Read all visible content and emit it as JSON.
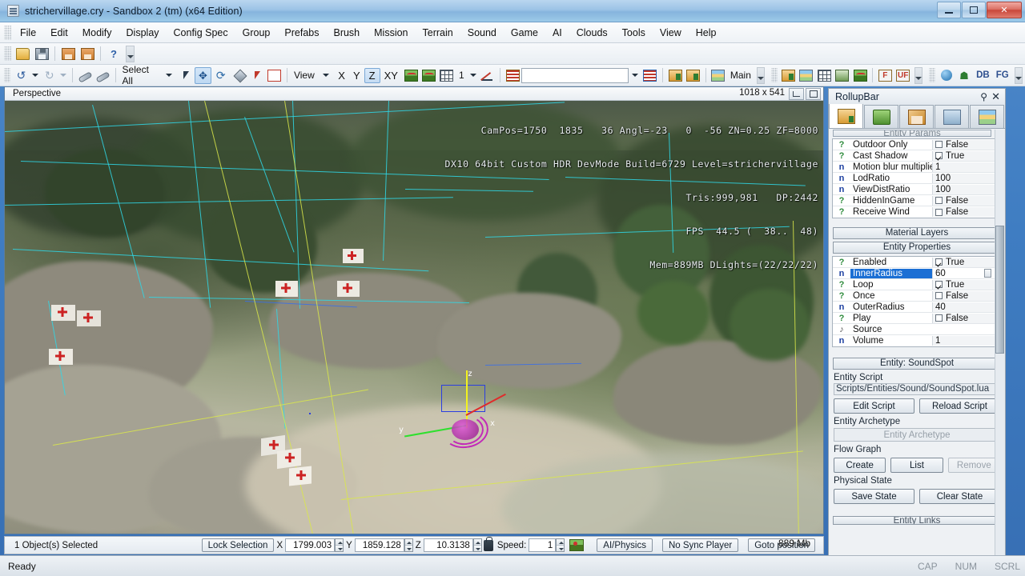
{
  "window": {
    "title": "strichervillage.cry - Sandbox 2 (tm) (x64 Edition)",
    "icon": "app-icon",
    "minimize": "–",
    "maximize": "▣",
    "close": "✕"
  },
  "menubar": {
    "items": [
      {
        "label": "File"
      },
      {
        "label": "Edit"
      },
      {
        "label": "Modify"
      },
      {
        "label": "Display"
      },
      {
        "label": "Config Spec"
      },
      {
        "label": "Group"
      },
      {
        "label": "Prefabs"
      },
      {
        "label": "Brush"
      },
      {
        "label": "Mission"
      },
      {
        "label": "Terrain"
      },
      {
        "label": "Sound"
      },
      {
        "label": "Game"
      },
      {
        "label": "AI"
      },
      {
        "label": "Clouds"
      },
      {
        "label": "Tools"
      },
      {
        "label": "View"
      },
      {
        "label": "Help"
      }
    ]
  },
  "toolbar_file": {
    "items": [
      {
        "name": "open-file-button",
        "icon": "folder-open-icon"
      },
      {
        "name": "save-button",
        "icon": "floppy-save-icon"
      },
      {
        "name": "save-level-resources-button",
        "icon": "save-down-icon"
      },
      {
        "name": "export-button",
        "icon": "save-up-icon"
      },
      {
        "name": "help-button",
        "icon": "question-mark-icon"
      }
    ],
    "overflow": "▾"
  },
  "toolbar_edit": {
    "undo": "undo-icon",
    "redo": "redo-icon",
    "link": "link-icon",
    "unlink": "unlink-icon",
    "select_combo": "Select All",
    "tools": [
      {
        "name": "select-tool",
        "icon": "arrow-cursor-icon",
        "active": false
      },
      {
        "name": "move-tool",
        "icon": "move-gizmo-icon",
        "active": true
      },
      {
        "name": "rotate-tool",
        "icon": "rotate-icon",
        "active": false
      },
      {
        "name": "scale-tool",
        "icon": "scale-icon",
        "active": false
      },
      {
        "name": "select-terrain-tool",
        "icon": "select-object-icon",
        "active": false
      },
      {
        "name": "select-area-tool",
        "icon": "select-area-icon",
        "active": false
      }
    ],
    "view_combo": "View",
    "axis_x": "X",
    "axis_y": "Y",
    "axis_z": "Z",
    "axis_xy": "XY",
    "terrain_snap": "terrain-snap-icon",
    "terrain_object_snap": "terrain-object-snap-icon",
    "grid_snap": "grid-snap-icon",
    "grid_value": "1",
    "angle_snap": "angle-snap-icon",
    "goto_selection": "goto-selection-icon",
    "layer_combo": "",
    "check_level": "check-level-icon",
    "import_button": "import-icon",
    "export_button": "export-icon",
    "layers_icon": "layers-icon",
    "layer_name": "Main",
    "right_tools": [
      {
        "name": "open-database-view-button",
        "icon": "database-icon"
      },
      {
        "name": "material-editor-button",
        "icon": "material-icon"
      },
      {
        "name": "terrain-editor-button",
        "icon": "terrain-grid-icon"
      },
      {
        "name": "character-editor-button",
        "icon": "character-icon"
      },
      {
        "name": "terrain-texture-button",
        "icon": "terrain-texture-icon"
      },
      {
        "name": "facial-editor-button",
        "icon": "facial-f-icon"
      },
      {
        "name": "ui-editor-button",
        "icon": "ui-f-icon"
      },
      {
        "name": "smart-objects-button",
        "icon": "blue-sphere-icon"
      },
      {
        "name": "ai-debugger-button",
        "icon": "green-man-icon"
      },
      {
        "name": "db-button",
        "icon": "db-text-icon"
      },
      {
        "name": "fg-button",
        "icon": "fg-text-icon"
      }
    ],
    "db_label": "DB",
    "fg_label": "FG"
  },
  "viewport": {
    "label": "Perspective",
    "resolution": "1018 x 541",
    "btn_maximize": "maximize-viewport-icon",
    "btn_layout": "viewport-layout-icon",
    "debug_lines": [
      "CamPos=1750  1835   36 Angl=-23   0  -56 ZN=0.25 ZF=8000",
      "DX10 64bit Custom HDR DevMode Build=6729 Level=strichervillage",
      "Tris:999,981   DP:2442",
      "FPS  44.5 (  38..  48)",
      "Mem=889MB DLights=(22/22/22)"
    ],
    "gizmo": {
      "x_label": "x",
      "y_label": "y",
      "z_label": "z"
    }
  },
  "rollup": {
    "title": "RollupBar",
    "pin_icon": "pin-icon",
    "close_icon": "close-icon",
    "tabs": [
      {
        "name": "tab-objects",
        "icon": "objects-icon",
        "active": true
      },
      {
        "name": "tab-terrain",
        "icon": "terrain-tab-icon",
        "active": false
      },
      {
        "name": "tab-modelling",
        "icon": "pencil-icon",
        "active": false
      },
      {
        "name": "tab-display",
        "icon": "display-monitor-icon",
        "active": false
      },
      {
        "name": "tab-layers",
        "icon": "layers-tab-icon",
        "active": false
      }
    ],
    "entity_params_header": "Entity Params",
    "entity_params": [
      {
        "type": "?",
        "name": "Outdoor Only",
        "value": "False",
        "kind": "bool",
        "checked": false
      },
      {
        "type": "?",
        "name": "Cast Shadow",
        "value": "True",
        "kind": "bool",
        "checked": true
      },
      {
        "type": "n",
        "name": "Motion blur multiplier",
        "value": "1",
        "kind": "num"
      },
      {
        "type": "n",
        "name": "LodRatio",
        "value": "100",
        "kind": "num"
      },
      {
        "type": "n",
        "name": "ViewDistRatio",
        "value": "100",
        "kind": "num"
      },
      {
        "type": "?",
        "name": "HiddenInGame",
        "value": "False",
        "kind": "bool",
        "checked": false
      },
      {
        "type": "?",
        "name": "Receive Wind",
        "value": "False",
        "kind": "bool",
        "checked": false
      }
    ],
    "material_layers_label": "Material Layers",
    "entity_properties_label": "Entity Properties",
    "entity_properties": [
      {
        "type": "?",
        "name": "Enabled",
        "value": "True",
        "kind": "bool",
        "checked": true,
        "selected": false
      },
      {
        "type": "n",
        "name": "InnerRadius",
        "value": "60",
        "kind": "spin",
        "selected": true
      },
      {
        "type": "?",
        "name": "Loop",
        "value": "True",
        "kind": "bool",
        "checked": true,
        "selected": false
      },
      {
        "type": "?",
        "name": "Once",
        "value": "False",
        "kind": "bool",
        "checked": false,
        "selected": false
      },
      {
        "type": "n",
        "name": "OuterRadius",
        "value": "40",
        "kind": "num",
        "selected": false
      },
      {
        "type": "?",
        "name": "Play",
        "value": "False",
        "kind": "bool",
        "checked": false,
        "selected": false
      },
      {
        "type": "s",
        "name": "Source",
        "value": "",
        "kind": "text",
        "selected": false
      },
      {
        "type": "n",
        "name": "Volume",
        "value": "1",
        "kind": "num",
        "selected": false
      }
    ],
    "entity_header": "Entity: SoundSpot",
    "entity_script_label": "Entity Script",
    "entity_script_path": "Scripts/Entities/Sound/SoundSpot.lua",
    "edit_script_button": "Edit Script",
    "reload_script_button": "Reload Script",
    "entity_archetype_label": "Entity Archetype",
    "entity_archetype_placeholder": "Entity Archetype",
    "flow_graph_label": "Flow Graph",
    "flow_create_button": "Create",
    "flow_list_button": "List",
    "flow_remove_button": "Remove",
    "physical_state_label": "Physical State",
    "save_state_button": "Save State",
    "clear_state_button": "Clear State",
    "entity_links_label": "Entity Links"
  },
  "statusbar": {
    "selection_text": "1 Object(s) Selected",
    "lock_selection_button": "Lock Selection",
    "x_label": "X",
    "x_value": "1799.003",
    "y_label": "Y",
    "y_value": "1859.128",
    "z_label": "Z",
    "z_value": "10.3138",
    "lock_icon": "lock-icon",
    "speed_label": "Speed:",
    "speed_value": "1",
    "terrain_icon": "terrain-map-icon",
    "ai_physics_button": "AI/Physics",
    "sync_player_button": "No Sync Player",
    "goto_position_button": "Goto position",
    "ready_text": "Ready",
    "memory": "889 Mb",
    "cap": "CAP",
    "num": "NUM",
    "scrl": "SCRL"
  },
  "colors": {
    "accent": "#1b6fd4",
    "titlebar": "#9cc3e6",
    "close_red": "#c9463a",
    "gizmo_x": "#e02b2b",
    "gizmo_y": "#2ee02e",
    "gizmo_z": "#f2f21e",
    "helper_cyan": "#2fd8e8",
    "helper_yellow": "#dbe84a",
    "sound_magenta": "#c22ab8"
  }
}
